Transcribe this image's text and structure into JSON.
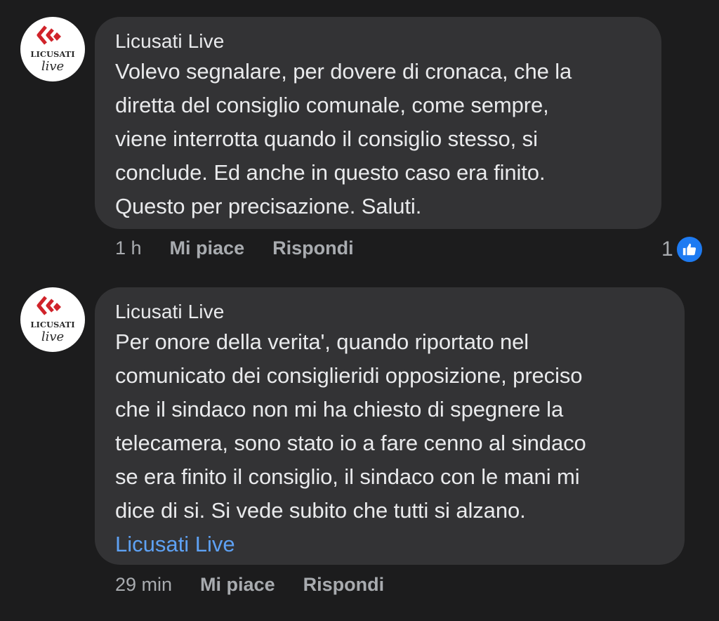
{
  "comments": [
    {
      "author": "Licusati Live",
      "avatar": {
        "brand_top": "LICUSATI",
        "brand_bottom": "live",
        "logo_color": "#d0232a"
      },
      "text": "Volevo segnalare, per dovere di cronaca, che la\ndiretta del consiglio comunale, come sempre,\nviene interrotta quando il consiglio stesso, si\nconclude. Ed anche in questo caso era finito.\nQuesto per precisazione. Saluti.",
      "mention": "",
      "time": "1 h",
      "like_label": "Mi piace",
      "reply_label": "Rispondi",
      "reaction_count": "1",
      "reaction_icon": "thumbs-up-icon"
    },
    {
      "author": "Licusati Live",
      "avatar": {
        "brand_top": "LICUSATI",
        "brand_bottom": "live",
        "logo_color": "#d0232a"
      },
      "text": "Per onore della verita', quando riportato nel\ncomunicato dei consiglieridi opposizione, preciso\nche il sindaco non mi ha chiesto di spegnere la\ntelecamera, sono stato io a fare cenno al sindaco\nse era finito il consiglio, il sindaco con le mani mi\ndice di si. Si vede subito che tutti si alzano.",
      "mention": "Licusati Live",
      "time": "29 min",
      "like_label": "Mi piace",
      "reply_label": "Rispondi"
    }
  ],
  "colors": {
    "background": "#1c1c1d",
    "bubble": "#333335",
    "mention": "#5ea1f3",
    "like_badge": "#1e7bf2"
  }
}
